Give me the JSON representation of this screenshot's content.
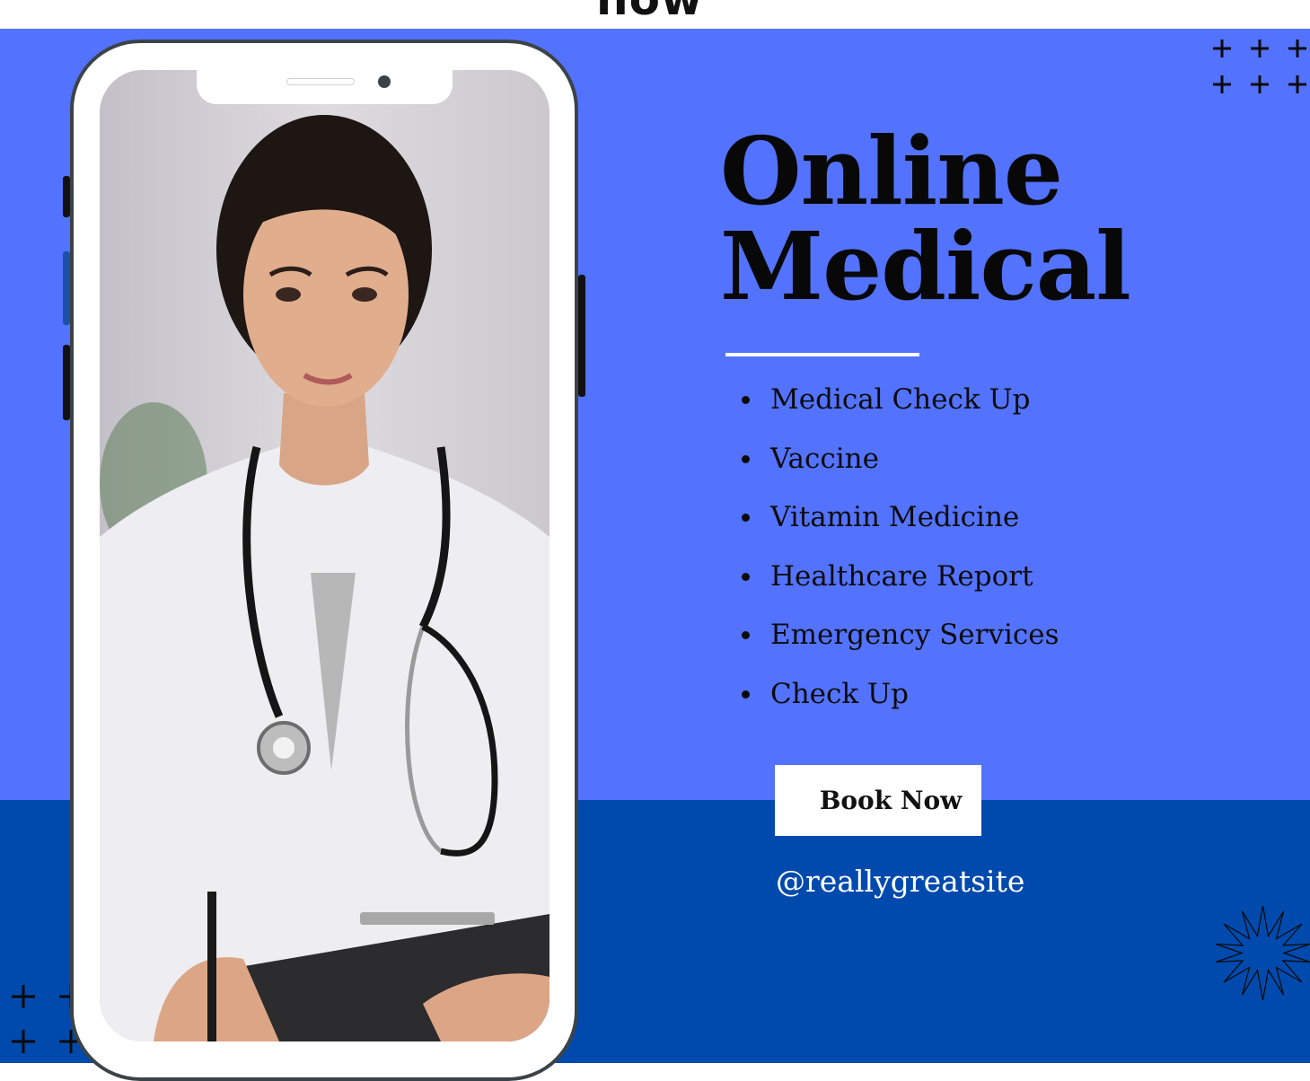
{
  "top_strip": {
    "partial_text": "now"
  },
  "headline": {
    "line1": "Online",
    "line2": "Medical"
  },
  "services": [
    "Medical Check Up",
    "Vaccine",
    "Vitamin Medicine",
    "Healthcare Report",
    "Emergency Services",
    "Check Up"
  ],
  "cta": {
    "label": "Book Now"
  },
  "handle": "@reallygreatsite",
  "colors": {
    "primary_blue": "#5373ff",
    "dark_blue": "#004aad",
    "text": "#080808",
    "white": "#ffffff"
  },
  "icons": [
    "plus-grid-icon",
    "starburst-icon",
    "doctor-photo"
  ]
}
